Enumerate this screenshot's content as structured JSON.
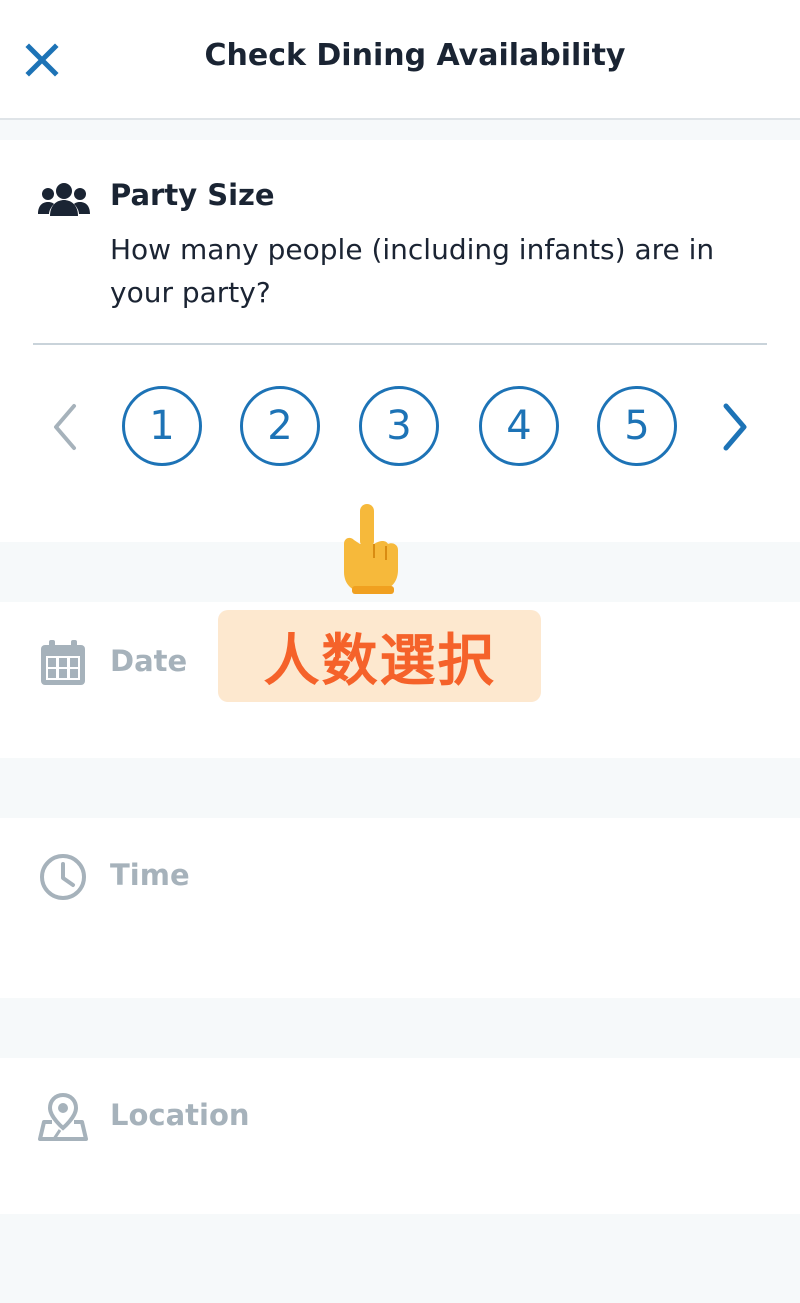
{
  "header": {
    "title": "Check Dining Availability",
    "close_icon": "close-icon"
  },
  "party": {
    "title": "Party Size",
    "description": "How many people (including infants) are in your party?",
    "icon": "group-people-icon",
    "sizes": [
      "1",
      "2",
      "3",
      "4",
      "5"
    ],
    "prev_icon": "chevron-left-icon",
    "next_icon": "chevron-right-icon"
  },
  "sections": {
    "date_label": "Date",
    "time_label": "Time",
    "location_label": "Location"
  },
  "overlay": {
    "text": "人数選択",
    "pointer_icon": "pointing-up-hand-icon"
  },
  "colors": {
    "accent": "#1d73b6",
    "disabled": "#a6b2bb",
    "overlay_bg": "#fde8cf",
    "overlay_text": "#f5622a",
    "page_bg": "#f6f9fa"
  }
}
